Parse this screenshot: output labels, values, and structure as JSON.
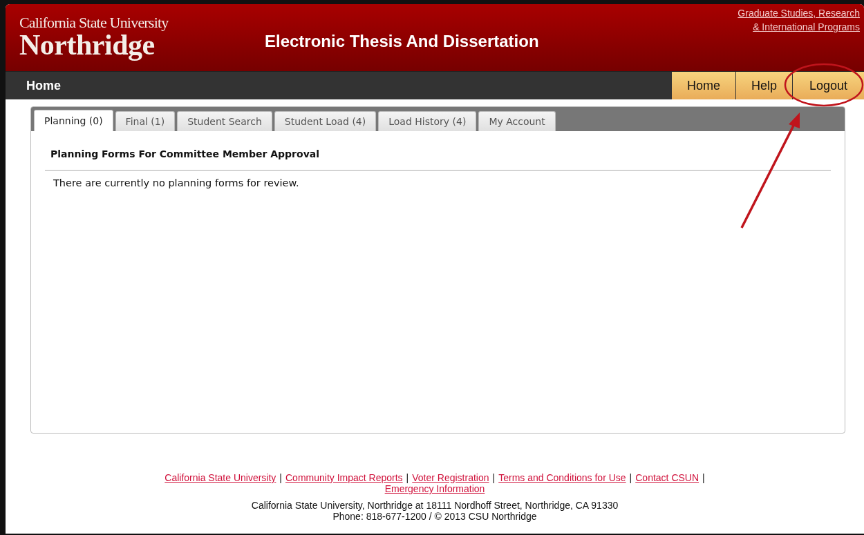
{
  "header": {
    "logo_top": "California State University",
    "logo_bottom": "Northridge",
    "title": "Electronic Thesis And Dissertation",
    "top_link_lines": [
      "Graduate Studies, Research",
      "& International Programs"
    ]
  },
  "nav": {
    "left": "Home",
    "buttons": [
      {
        "label": "Home"
      },
      {
        "label": "Help"
      },
      {
        "label": "Logout"
      }
    ]
  },
  "tabs": [
    {
      "label": "Planning (0)",
      "selected": true
    },
    {
      "label": "Final (1)",
      "selected": false
    },
    {
      "label": "Student Search",
      "selected": false
    },
    {
      "label": "Student Load (4)",
      "selected": false
    },
    {
      "label": "Load History (4)",
      "selected": false
    },
    {
      "label": "My Account",
      "selected": false
    }
  ],
  "panel": {
    "heading": "Planning Forms For Committee Member Approval",
    "message": "There are currently no planning forms for review."
  },
  "footer": {
    "links": [
      {
        "label": "California State University",
        "separator": "|"
      },
      {
        "label": "Community Impact Reports",
        "separator": "|"
      },
      {
        "label": "Voter Registration",
        "separator": "|"
      },
      {
        "label": "Terms and Conditions for Use",
        "separator": "|"
      },
      {
        "label": "Contact CSUN",
        "separator": "|"
      },
      {
        "label": "Emergency Information"
      }
    ],
    "address": "California State University, Northridge at 18111 Nordhoff Street, Northridge, CA 91330",
    "phone": "Phone: 818-677-1200 / © 2013 CSU Northridge"
  }
}
